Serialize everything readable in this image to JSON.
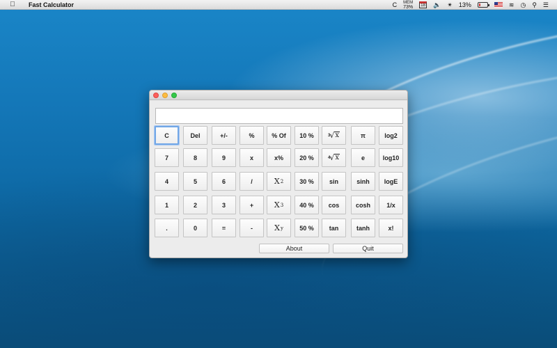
{
  "menubar": {
    "app_name": "Fast Calculator",
    "status": {
      "c_label": "C",
      "mem_label": "MEM",
      "mem_value": "73%",
      "calendar_day": "18",
      "battery_percent": "13%",
      "battery_level": 0.13
    }
  },
  "calculator": {
    "display_value": "",
    "rows": [
      [
        {
          "label": "C",
          "name": "clear"
        },
        {
          "label": "Del",
          "name": "delete"
        },
        {
          "label": "+/-",
          "name": "sign"
        },
        {
          "label": "%",
          "name": "percent"
        },
        {
          "label": "% Of",
          "name": "percent-of"
        },
        {
          "label": "10 %",
          "name": "10-percent"
        },
        {
          "label": "3",
          "kind": "root",
          "name": "cube-root"
        },
        {
          "label": "π",
          "name": "pi"
        },
        {
          "label": "log2",
          "name": "log2"
        }
      ],
      [
        {
          "label": "7",
          "name": "digit-7"
        },
        {
          "label": "8",
          "name": "digit-8"
        },
        {
          "label": "9",
          "name": "digit-9"
        },
        {
          "label": "x",
          "name": "multiply"
        },
        {
          "label": "x%",
          "name": "x-percent"
        },
        {
          "label": "20 %",
          "name": "20-percent"
        },
        {
          "label": "4",
          "kind": "root",
          "name": "fourth-root"
        },
        {
          "label": "e",
          "name": "euler"
        },
        {
          "label": "log10",
          "name": "log10"
        }
      ],
      [
        {
          "label": "4",
          "name": "digit-4"
        },
        {
          "label": "5",
          "name": "digit-5"
        },
        {
          "label": "6",
          "name": "digit-6"
        },
        {
          "label": "/",
          "name": "divide"
        },
        {
          "label": "2",
          "kind": "power",
          "name": "square"
        },
        {
          "label": "30 %",
          "name": "30-percent"
        },
        {
          "label": "sin",
          "name": "sin"
        },
        {
          "label": "sinh",
          "name": "sinh"
        },
        {
          "label": "logE",
          "name": "loge"
        }
      ],
      [
        {
          "label": "1",
          "name": "digit-1"
        },
        {
          "label": "2",
          "name": "digit-2"
        },
        {
          "label": "3",
          "name": "digit-3"
        },
        {
          "label": "+",
          "name": "add"
        },
        {
          "label": "3",
          "kind": "power",
          "name": "cube"
        },
        {
          "label": "40 %",
          "name": "40-percent"
        },
        {
          "label": "cos",
          "name": "cos"
        },
        {
          "label": "cosh",
          "name": "cosh"
        },
        {
          "label": "1/x",
          "name": "reciprocal"
        }
      ],
      [
        {
          "label": ".",
          "name": "decimal"
        },
        {
          "label": "0",
          "name": "digit-0"
        },
        {
          "label": "=",
          "name": "equals"
        },
        {
          "label": "-",
          "name": "subtract"
        },
        {
          "label": "y",
          "kind": "power",
          "name": "power-y"
        },
        {
          "label": "50 %",
          "name": "50-percent"
        },
        {
          "label": "tan",
          "name": "tan"
        },
        {
          "label": "tanh",
          "name": "tanh"
        },
        {
          "label": "x!",
          "name": "factorial"
        }
      ]
    ],
    "about_label": "About",
    "quit_label": "Quit"
  }
}
